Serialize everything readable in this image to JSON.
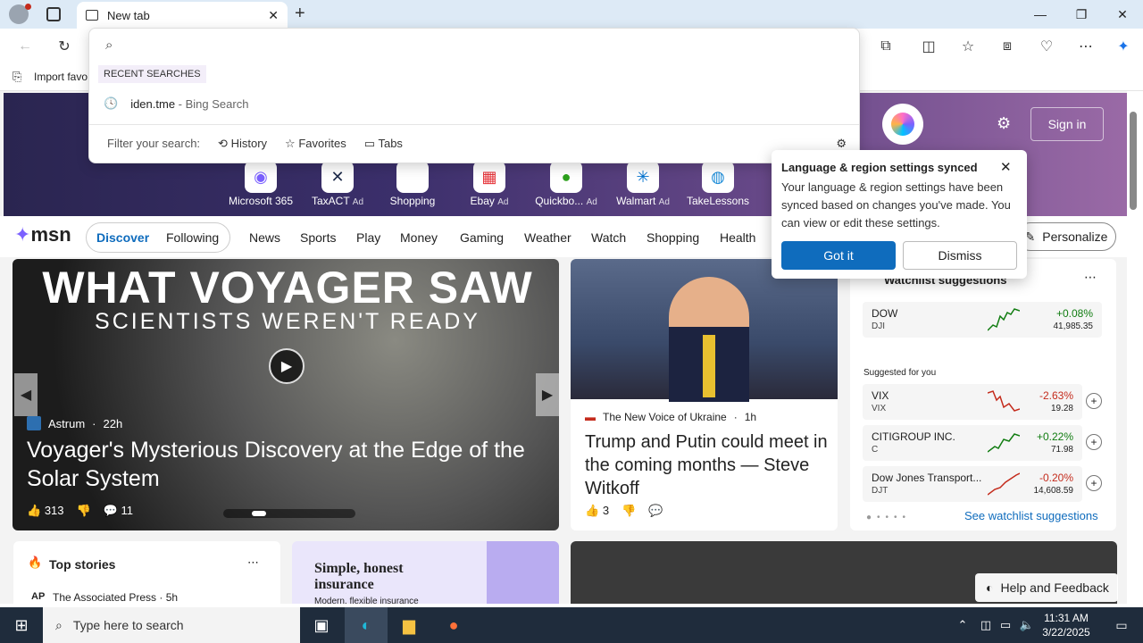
{
  "browser": {
    "tab_title": "New tab",
    "import_favorites": "Import favo",
    "search_value": ""
  },
  "dropdown": {
    "recent_header": "RECENT SEARCHES",
    "recent_item": "iden.tme",
    "recent_item_source": " - Bing Search",
    "filter_label": "Filter your search:",
    "filters": [
      "History",
      "Favorites",
      "Tabs"
    ]
  },
  "flyout": {
    "title": "Language & region settings synced",
    "body": "Your language & region settings have been synced based on changes you've made. You can view or edit these settings.",
    "primary": "Got it",
    "secondary": "Dismiss"
  },
  "hero": {
    "sign_in": "Sign in",
    "apps": [
      {
        "label": "Microsoft 365",
        "ad": ""
      },
      {
        "label": "TaxACT",
        "ad": "Ad"
      },
      {
        "label": "Shopping",
        "ad": ""
      },
      {
        "label": "Ebay",
        "ad": "Ad"
      },
      {
        "label": "Quickbo...",
        "ad": "Ad"
      },
      {
        "label": "Walmart",
        "ad": "Ad"
      },
      {
        "label": "TakeLessons",
        "ad": ""
      }
    ]
  },
  "msn": {
    "logo": "msn",
    "pill": [
      "Discover",
      "Following"
    ],
    "nav": [
      "News",
      "Sports",
      "Play",
      "Money",
      "Gaming",
      "Weather",
      "Watch",
      "Shopping",
      "Health"
    ],
    "personalize": "Personalize"
  },
  "main_story": {
    "image_headline": "WHAT VOYAGER SAW",
    "image_subheadline": "SCIENTISTS WEREN'T READY",
    "source": "Astrum",
    "age": "22h",
    "title": "Voyager's Mysterious Discovery at the Edge of the Solar System",
    "likes": "313",
    "comments": "11"
  },
  "story2": {
    "source": "The New Voice of Ukraine",
    "age": "1h",
    "title": "Trump and Putin could meet in the coming months — Steve Witkoff",
    "likes": "3"
  },
  "watchlist": {
    "title": "Watchlist suggestions",
    "suggested_label": "Suggested for you",
    "see_more": "See watchlist suggestions",
    "stocks": [
      {
        "name": "DOW",
        "symbol": "DJI",
        "change": "+0.08%",
        "price": "41,985.35",
        "dir": "pos"
      },
      {
        "name": "VIX",
        "symbol": "VIX",
        "change": "-2.63%",
        "price": "19.28",
        "dir": "neg"
      },
      {
        "name": "CITIGROUP INC.",
        "symbol": "C",
        "change": "+0.22%",
        "price": "71.98",
        "dir": "pos"
      },
      {
        "name": "Dow Jones Transport...",
        "symbol": "DJT",
        "change": "-0.20%",
        "price": "14,608.59",
        "dir": "neg"
      }
    ]
  },
  "bottom": {
    "top_stories": "Top stories",
    "top_source": "The Associated Press · 5h",
    "insurance_title": "Simple, honest insurance",
    "insurance_sub": "Modern, flexible insurance",
    "help": "Help and Feedback"
  },
  "taskbar": {
    "search_placeholder": "Type here to search",
    "time": "11:31 AM",
    "date": "3/22/2025"
  }
}
